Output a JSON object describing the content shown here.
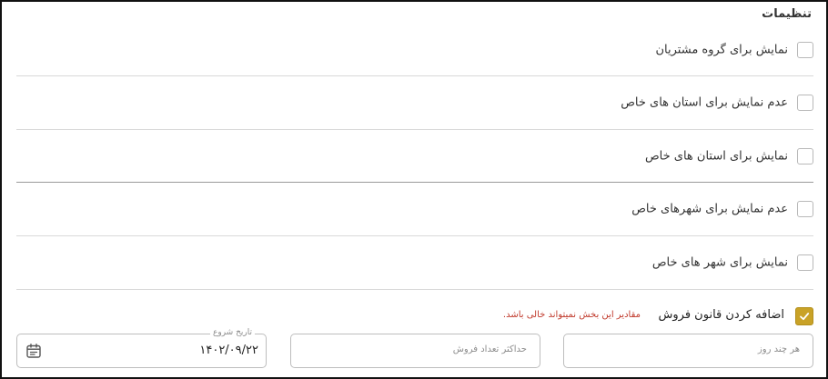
{
  "settings": {
    "title": "تنظیمات",
    "options": [
      {
        "label": "نمایش برای گروه مشتریان",
        "checked": false
      },
      {
        "label": "عدم نمایش برای استان های خاص",
        "checked": false
      },
      {
        "label": "نمایش برای استان های خاص",
        "checked": false
      },
      {
        "label": "عدم نمایش برای شهرهای خاص",
        "checked": false
      },
      {
        "label": "نمایش برای شهر های خاص",
        "checked": false
      }
    ],
    "sales_rule": {
      "label": "اضافه کردن قانون فروش",
      "checked": true,
      "error": "مقادیر این بخش نمیتواند خالی باشد."
    },
    "fields": {
      "every_days": {
        "placeholder": "هر چند روز",
        "value": ""
      },
      "max_sales": {
        "placeholder": "حداکثر تعداد فروش",
        "value": ""
      },
      "start_date": {
        "label": "تاریخ شروع",
        "value": "۱۴۰۲/۰۹/۲۲"
      }
    }
  },
  "colors": {
    "accent": "#c9a227",
    "error": "#c0392b",
    "border": "#bdbdbd",
    "divider": "#d9d9d9"
  },
  "icons": {
    "check": "check-icon",
    "calendar": "calendar-icon"
  }
}
